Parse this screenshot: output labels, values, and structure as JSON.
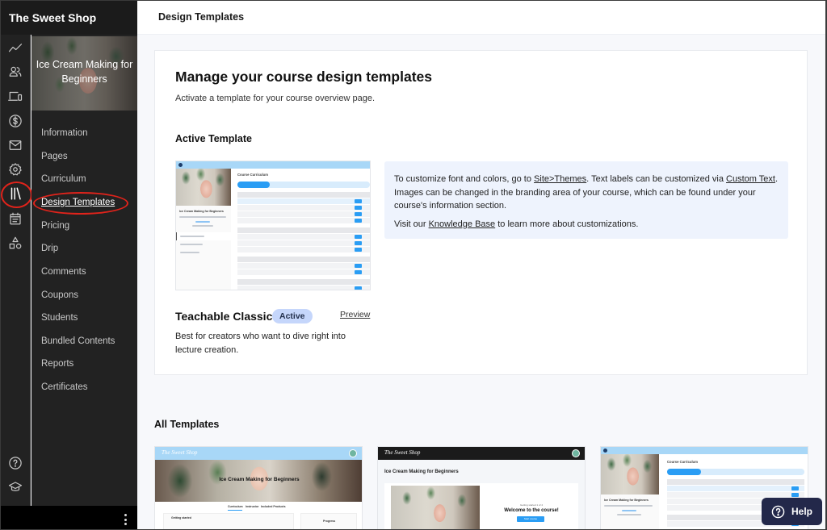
{
  "app": {
    "brand": "The Sweet Shop"
  },
  "icon_rail": [
    {
      "name": "analytics-icon",
      "active": false
    },
    {
      "name": "users-icon",
      "active": false
    },
    {
      "name": "devices-icon",
      "active": false
    },
    {
      "name": "dollar-icon",
      "active": false
    },
    {
      "name": "mail-icon",
      "active": false
    },
    {
      "name": "gear-icon",
      "active": false
    },
    {
      "name": "library-icon",
      "active": true
    },
    {
      "name": "calendar-icon",
      "active": false
    },
    {
      "name": "shapes-icon",
      "active": false
    }
  ],
  "icon_rail_bottom": [
    {
      "name": "help-circle-icon"
    },
    {
      "name": "graduation-cap-icon"
    }
  ],
  "course": {
    "title": "Ice Cream Making for Beginners"
  },
  "subnav": {
    "items": [
      {
        "label": "Information"
      },
      {
        "label": "Pages"
      },
      {
        "label": "Curriculum"
      },
      {
        "label": "Design Templates",
        "active": true
      },
      {
        "label": "Pricing"
      },
      {
        "label": "Drip"
      },
      {
        "label": "Comments"
      },
      {
        "label": "Coupons"
      },
      {
        "label": "Students"
      },
      {
        "label": "Bundled Contents"
      },
      {
        "label": "Reports"
      },
      {
        "label": "Certificates"
      }
    ]
  },
  "header": {
    "title": "Design Templates"
  },
  "main": {
    "heading": "Manage your course design templates",
    "subheading": "Activate a template for your course overview page.",
    "active_section_title": "Active Template",
    "active_template": {
      "name": "Teachable Classic",
      "badge": "Active",
      "preview_label": "Preview",
      "description": "Best for creators who want to dive right into lecture creation.",
      "thumbnail": {
        "course_title": "Ice Cream Making for Beginners",
        "section_title": "Course Curriculum",
        "cta": "Start next lecture"
      }
    },
    "info": {
      "p1_pre": "To customize font and colors, go to ",
      "p1_link1": "Site>Themes",
      "p1_mid": ". Text labels can be customized via ",
      "p1_link2": "Custom Text",
      "p1_post": ". Images can be changed in the branding area of your course, which can be found under your course's information section.",
      "p2_pre": "Visit our ",
      "p2_link": "Knowledge Base",
      "p2_post": " to learn more about customizations."
    },
    "all_templates_title": "All Templates",
    "all_templates": [
      {
        "brand": "The Sweet Shop",
        "course_title": "Ice Cream Making for Beginners",
        "tabs": [
          "Curriculum",
          "Instructor",
          "Included Products"
        ],
        "section": "Getting started",
        "side_label": "Progress",
        "header_color": "#a8d7f7"
      },
      {
        "brand": "The Sweet Shop",
        "course_title": "Ice Cream Making for Beginners",
        "welcome": "Welcome to the course!",
        "subtitle": "Getting started 1 of 4",
        "button": "Start course",
        "header_color": "#1b1b1b"
      },
      {
        "course_title": "Ice Cream Making for Beginners",
        "section_title": "Course Curriculum",
        "cta": "Start next lecture",
        "header_color": "#a8d7f7"
      }
    ]
  },
  "help_button": {
    "label": "Help"
  },
  "colors": {
    "accent": "#2a9df4",
    "annotation": "#e0231b",
    "badge_bg": "#c5d6fb",
    "help_bg": "#23284a"
  }
}
